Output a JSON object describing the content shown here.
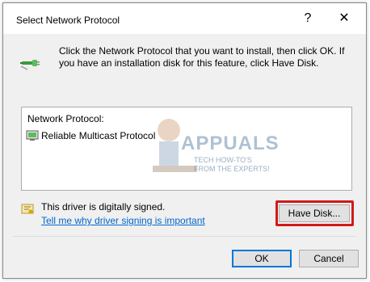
{
  "window": {
    "title": "Select Network Protocol",
    "help_glyph": "?",
    "close_glyph": "✕"
  },
  "instructions": "Click the Network Protocol that you want to install, then click OK. If you have an installation disk for this feature, click Have Disk.",
  "protocol_list": {
    "header": "Network Protocol:",
    "items": [
      {
        "label": "Reliable Multicast Protocol",
        "icon": "network-adapter-icon"
      }
    ]
  },
  "watermark": {
    "brand": "APPUALS",
    "tagline": "TECH HOW-TO'S FROM THE EXPERTS!"
  },
  "driver": {
    "status": "This driver is digitally signed.",
    "link": "Tell me why driver signing is important"
  },
  "buttons": {
    "have_disk": "Have Disk...",
    "ok": "OK",
    "cancel": "Cancel"
  },
  "colors": {
    "highlight": "#d11a1a",
    "link": "#0066cc",
    "default_button_border": "#0078d7"
  }
}
